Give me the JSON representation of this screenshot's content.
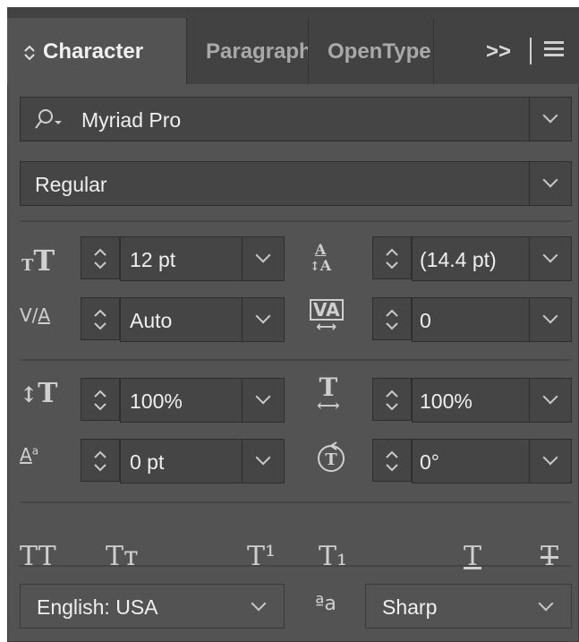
{
  "tabs": [
    {
      "label": "Character",
      "active": true
    },
    {
      "label": "Paragraph",
      "active": false
    },
    {
      "label": "OpenType",
      "active": false
    }
  ],
  "overflow_label": ">>",
  "font": {
    "family": "Myriad Pro",
    "style": "Regular"
  },
  "rows": {
    "font_size": "12 pt",
    "leading": "(14.4 pt)",
    "kerning": "Auto",
    "tracking": "0",
    "vertical_scale": "100%",
    "horizontal_scale": "100%",
    "baseline_shift": "0 pt",
    "rotation": "0°"
  },
  "caps_buttons": [
    {
      "icon": "all-caps-icon",
      "glyph": "TT"
    },
    {
      "icon": "small-caps-icon",
      "glyph": "Tт"
    },
    {
      "icon": "superscript-icon",
      "glyph": "T¹"
    },
    {
      "icon": "subscript-icon",
      "glyph": "T₁"
    },
    {
      "icon": "underline-icon",
      "glyph": "T"
    },
    {
      "icon": "strikethrough-icon",
      "glyph": "T"
    }
  ],
  "language": "English: USA",
  "antialias": {
    "icon_glyph": "ªa",
    "value": "Sharp"
  },
  "colors": {
    "panel": "#535353",
    "tabbar": "#424242",
    "field": "#454545",
    "text": "#efefef"
  }
}
